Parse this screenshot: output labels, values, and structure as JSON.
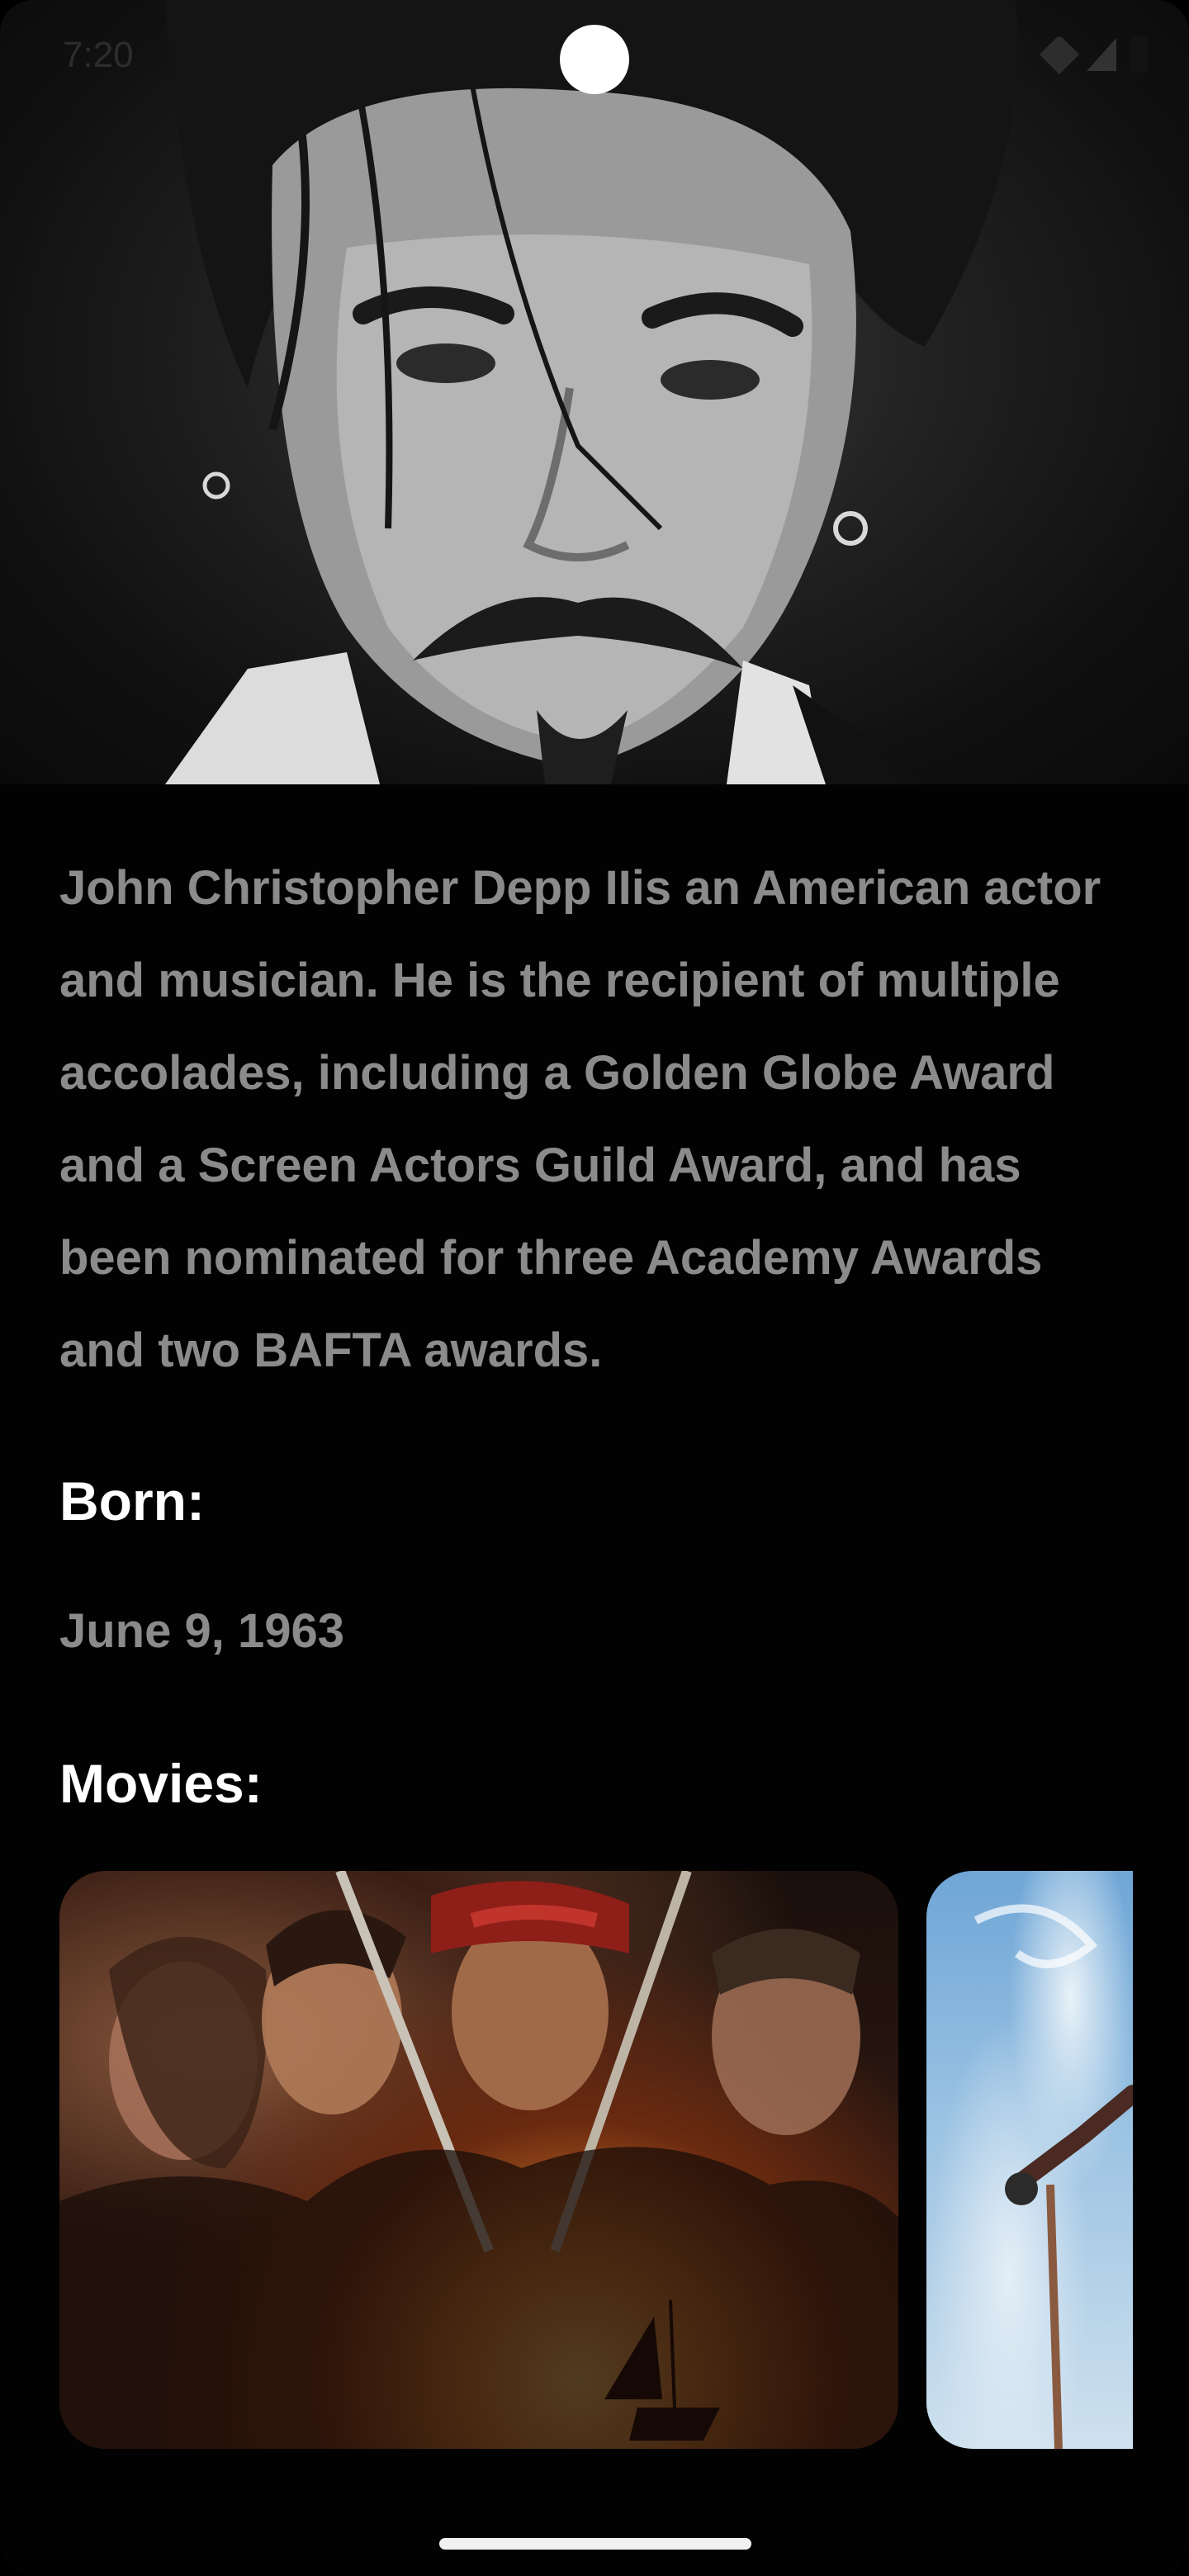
{
  "status_bar": {
    "time": "7:20",
    "icons": [
      "signal-icon",
      "wifi-icon",
      "battery-icon"
    ]
  },
  "actor": {
    "bio": "John Christopher Depp IIis an American actor and musician. He is the recipient of multiple accolades, including a Golden Globe Award and a Screen Actors Guild Award, and has been nominated for three Academy Awards and two BAFTA awards.",
    "born_label": "Born:",
    "born_value": "June 9, 1963",
    "movies_label": "Movies:"
  },
  "colors": {
    "background": "#020202",
    "body_text": "#8b8b8b",
    "heading_text": "#ffffff"
  }
}
